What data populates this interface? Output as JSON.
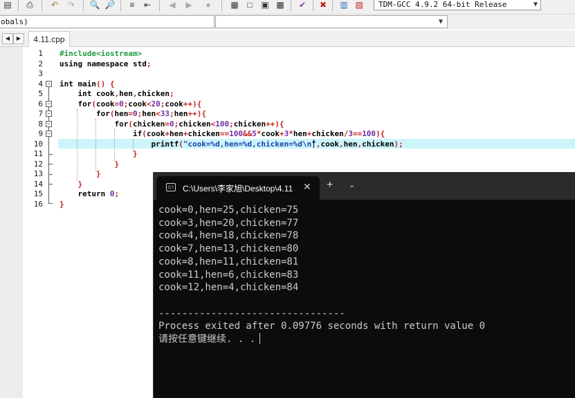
{
  "toolbar": {
    "compiler": "TDM-GCC 4.9.2 64-bit Release",
    "icons": [
      "print-icon",
      "find-icon",
      "replace-icon",
      "indent-icon",
      "unindent-icon",
      "compile-icon",
      "run-icon",
      "compile-run-icon",
      "rebuild-icon",
      "check-icon",
      "stop-icon",
      "chart-icon",
      "error-chart-icon"
    ]
  },
  "scope": {
    "left_value": "obals)",
    "right_value": ""
  },
  "tabs": {
    "active": "4.11.cpp"
  },
  "editor": {
    "line_numbers": [
      "1",
      "2",
      "3",
      "4",
      "5",
      "6",
      "7",
      "8",
      "9",
      "10",
      "11",
      "12",
      "13",
      "14",
      "15",
      "16"
    ]
  },
  "terminal": {
    "title": "C:\\Users\\李家旭\\Desktop\\4.11",
    "lines": [
      "cook=0,hen=25,chicken=75",
      "cook=3,hen=20,chicken=77",
      "cook=4,hen=18,chicken=78",
      "cook=7,hen=13,chicken=80",
      "cook=8,hen=11,chicken=81",
      "cook=11,hen=6,chicken=83",
      "cook=12,hen=4,chicken=84",
      "",
      "--------------------------------",
      "Process exited after 0.09776 seconds with return value 0",
      "请按任意键继续. . ."
    ]
  },
  "colors": {
    "highlight": "#ccf5fb",
    "preprocessor": "#1f9b3f",
    "string": "#1f3fb0",
    "number": "#6d2fa0",
    "operator": "#c21f1f"
  }
}
